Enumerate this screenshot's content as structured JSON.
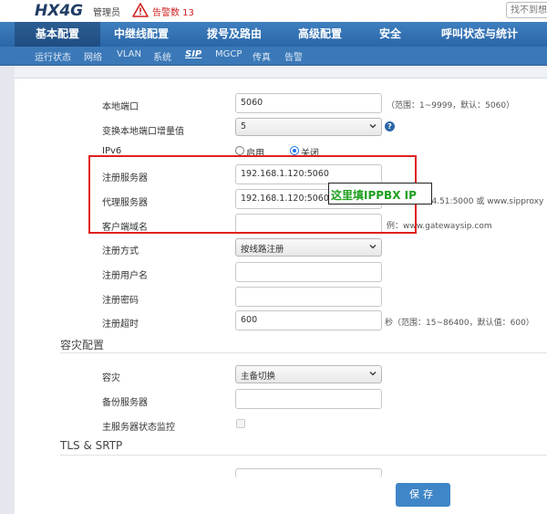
{
  "header": {
    "logo": "HX4G",
    "user": "管理员",
    "alarm": "告警数 13",
    "search_placeholder": "找不到想"
  },
  "main_nav": [
    {
      "label": "基本配置",
      "active": true
    },
    {
      "label": "中继线配置",
      "active": false
    },
    {
      "label": "拨号及路由",
      "active": false
    },
    {
      "label": "高级配置",
      "active": false
    },
    {
      "label": "安全",
      "active": false
    },
    {
      "label": "呼叫状态与统计",
      "active": false
    }
  ],
  "sub_nav": [
    {
      "label": "运行状态",
      "active": false
    },
    {
      "label": "网络",
      "active": false
    },
    {
      "label": "VLAN",
      "active": false
    },
    {
      "label": "系统",
      "active": false
    },
    {
      "label": "SIP",
      "active": true
    },
    {
      "label": "MGCP",
      "active": false
    },
    {
      "label": "传真",
      "active": false
    },
    {
      "label": "告警",
      "active": false
    }
  ],
  "form": {
    "local_port": {
      "label": "本地端口",
      "value": "5060",
      "hint": "（范围：1~9999，默认：5060）"
    },
    "port_increment": {
      "label": "变换本地端口增量值",
      "value": "5"
    },
    "ipv6": {
      "label": "IPv6",
      "option_on": "启用",
      "option_off": "关闭",
      "selected": "关闭"
    },
    "register_server": {
      "label": "注册服务器",
      "value": "192.168.1.120:5060"
    },
    "proxy_server": {
      "label": "代理服务器",
      "value": "192.168.1.120:5060",
      "hint": "例：168.134.51:5000 或 www.sipproxy"
    },
    "client_domain": {
      "label": "客户端域名",
      "value": "",
      "hint": "例：www.gatewaysip.com"
    },
    "register_mode": {
      "label": "注册方式",
      "value": "按线路注册"
    },
    "register_user": {
      "label": "注册用户名",
      "value": ""
    },
    "register_password": {
      "label": "注册密码",
      "value": ""
    },
    "register_timeout": {
      "label": "注册超时",
      "value": "600",
      "hint": "秒（范围：15~86400，默认值：600）"
    }
  },
  "disaster": {
    "title": "容灾配置",
    "mode": {
      "label": "容灾",
      "value": "主备切换"
    },
    "backup_server": {
      "label": "备份服务器",
      "value": ""
    },
    "monitor": {
      "label": "主服务器状态监控"
    }
  },
  "tls": {
    "title": "TLS & SRTP"
  },
  "annotation": "这里填IPPBX IP",
  "save_label": "保存",
  "colors": {
    "nav": "#2a66a8",
    "alarm": "#d02020",
    "annotation_box": "#e02020",
    "annotation_text": "#1fa01f"
  }
}
